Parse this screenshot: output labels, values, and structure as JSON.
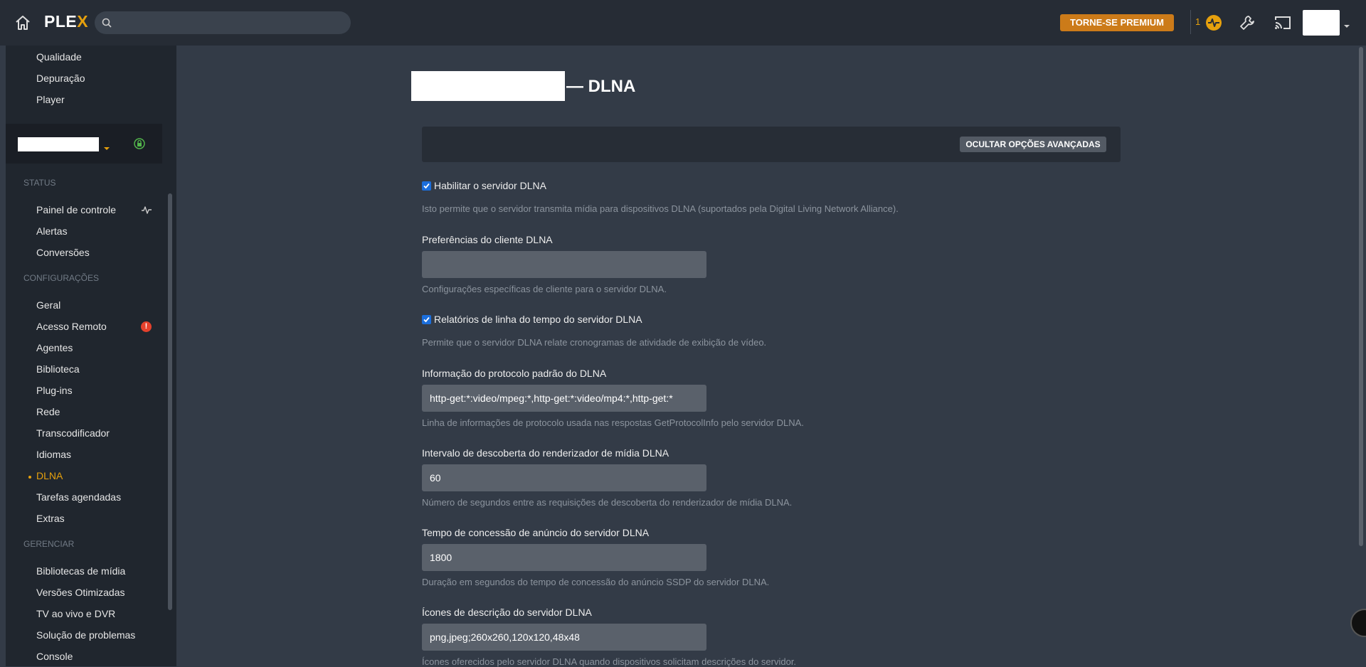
{
  "topbar": {
    "logo_text": "PLEX",
    "logo_text_main": "PLE",
    "logo_text_x": "X",
    "search_placeholder": "",
    "premium_label": "TORNE-SE PREMIUM",
    "activity_count": "1",
    "icons": [
      "home-icon",
      "search-icon",
      "activity-icon",
      "wrench-icon",
      "cast-icon",
      "chevron-down-icon"
    ]
  },
  "sidebar": {
    "top_items": [
      "Qualidade",
      "Depuração",
      "Player"
    ],
    "server_icon": "lock-icon",
    "status_header": "STATUS",
    "status_items": [
      "Painel de controle",
      "Alertas",
      "Conversões"
    ],
    "settings_header": "CONFIGURAÇÕES",
    "settings_items": [
      "Geral",
      "Acesso Remoto",
      "Agentes",
      "Biblioteca",
      "Plug-ins",
      "Rede",
      "Transcodificador",
      "Idiomas",
      "DLNA",
      "Tarefas agendadas",
      "Extras"
    ],
    "remote_alert": "!",
    "active_item": "DLNA",
    "manage_header": "GERENCIAR",
    "manage_items": [
      "Bibliotecas de mídia",
      "Versões Otimizadas",
      "TV ao vivo e DVR",
      "Solução de problemas",
      "Console"
    ]
  },
  "main": {
    "title_suffix": "— DLNA",
    "advanced_button": "OCULTAR OPÇÕES AVANÇADAS",
    "enable_dlna": {
      "checked": true,
      "label": "Habilitar o servidor DLNA",
      "help": "Isto permite que o servidor transmita mídia para dispositivos DLNA (suportados pela Digital Living Network Alliance)."
    },
    "client_prefs": {
      "label": "Preferências do cliente DLNA",
      "value": "",
      "help": "Configurações específicas de cliente para o servidor DLNA."
    },
    "timeline_reports": {
      "checked": true,
      "label": "Relatórios de linha do tempo do servidor DLNA",
      "help": "Permite que o servidor DLNA relate cronogramas de atividade de exibição de vídeo."
    },
    "protocol_info": {
      "label": "Informação do protocolo padrão do DLNA",
      "value": "http-get:*:video/mpeg:*,http-get:*:video/mp4:*,http-get:*",
      "help": "Linha de informações de protocolo usada nas respostas GetProtocolInfo pelo servidor DLNA."
    },
    "discovery_interval": {
      "label": "Intervalo de descoberta do renderizador de mídia DLNA",
      "value": "60",
      "help": "Número de segundos entre as requisições de descoberta do renderizador de mídia DLNA."
    },
    "announce_lease": {
      "label": "Tempo de concessão de anúncio do servidor DLNA",
      "value": "1800",
      "help": "Duração em segundos do tempo de concessão do anúncio SSDP do servidor DLNA."
    },
    "description_icons": {
      "label": "Ícones de descrição do servidor DLNA",
      "value": "png,jpeg;260x260,120x120,48x48",
      "help": "Ícones oferecidos pelo servidor DLNA quando dispositivos solicitam descrições do servidor."
    }
  },
  "colors": {
    "accent": "#e5a00d",
    "premium_button": "#cc7b19",
    "background": "#333b47",
    "sidebar": "#20262e",
    "topbar": "#262c35",
    "alert": "#e5412c"
  }
}
